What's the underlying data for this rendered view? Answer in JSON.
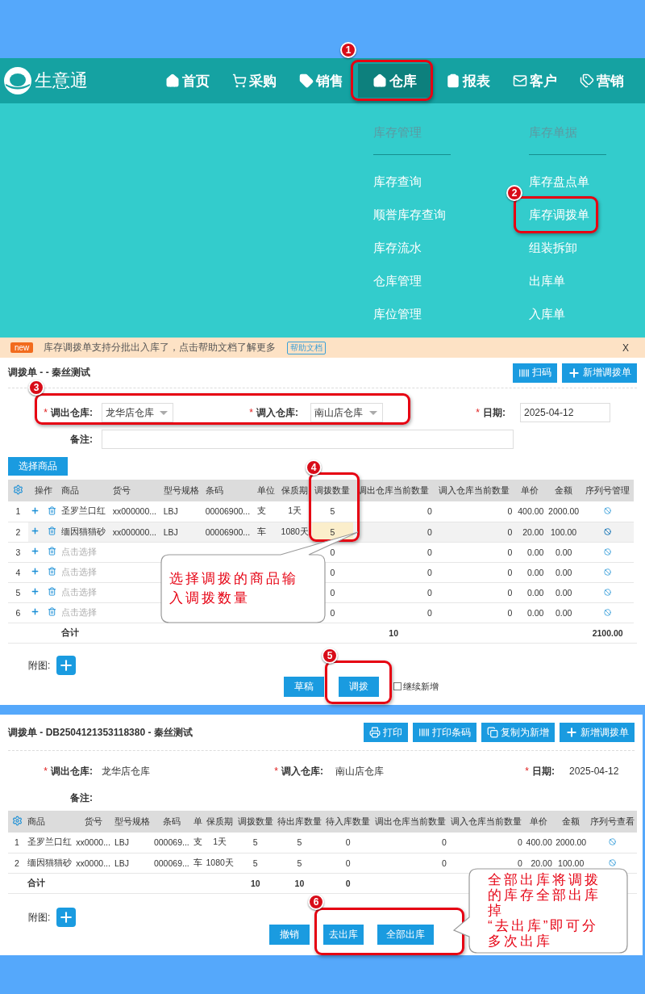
{
  "nav": {
    "logo": "生意通",
    "items": [
      {
        "label": "首页",
        "selected": false
      },
      {
        "label": "采购",
        "selected": false
      },
      {
        "label": "销售",
        "selected": false
      },
      {
        "label": "仓库",
        "selected": true
      },
      {
        "label": "报表",
        "selected": false
      },
      {
        "label": "客户",
        "selected": false
      },
      {
        "label": "营销",
        "selected": false
      }
    ]
  },
  "menu": {
    "columns": [
      {
        "title": "库存管理",
        "items": [
          "库存查询",
          "顺誉库存查询",
          "库存流水",
          "仓库管理",
          "库位管理"
        ]
      },
      {
        "title": "库存单据",
        "items": [
          "库存盘点单",
          "库存调拨单",
          "组装拆卸",
          "出库单",
          "入库单"
        ]
      }
    ]
  },
  "notice": {
    "badge": "new",
    "text": "库存调拨单支持分批出入库了，点击帮助文档了解更多",
    "link": "帮助文档",
    "close": "X"
  },
  "draft": {
    "title": "调拨单 - - 秦丝测试",
    "buttons": [
      "扫码",
      "新增调拨单"
    ],
    "fields": [
      {
        "mark": "*",
        "label": "调出仓库:",
        "value": "龙华店仓库",
        "kind": "select"
      },
      {
        "mark": "*",
        "label": "调入仓库:",
        "value": "南山店仓库",
        "kind": "select"
      },
      {
        "mark": "*",
        "label": "日期:",
        "value": "2025-04-12",
        "kind": "input"
      },
      {
        "label": "备注:",
        "kind": "input"
      }
    ],
    "select_button": "选择商品",
    "table": {
      "columns": [
        "操作",
        "商品",
        "货号",
        "型号规格",
        "条码",
        "单位",
        "保质期",
        "调拨数量",
        "调出仓库当前数量",
        "调入仓库当前数量",
        "单价",
        "金额",
        "序列号管理"
      ],
      "rows": [
        {
          "index": "1",
          "kind": "item",
          "selected": false,
          "product": "圣罗兰口红",
          "sku": "xx000000...",
          "spec": "LBJ",
          "barcode": "00006900...",
          "unit": "支",
          "shelf_life": "1天",
          "quantity": "5",
          "out_stock": "0",
          "in_stock": "0",
          "price": "400.00",
          "amount": "2000.00"
        },
        {
          "index": "2",
          "kind": "item",
          "selected": true,
          "product": "缅因猫猫砂",
          "sku": "xx000000...",
          "spec": "LBJ",
          "barcode": "00006900...",
          "unit": "车",
          "shelf_life": "1080天",
          "quantity": "5",
          "out_stock": "0",
          "in_stock": "0",
          "price": "20.00",
          "amount": "100.00"
        },
        {
          "index": "3",
          "kind": "empty",
          "selected": false,
          "placeholder": "点击选择",
          "quantity": "0",
          "out_stock": "0",
          "in_stock": "0",
          "price": "0.00",
          "amount": "0.00"
        },
        {
          "index": "4",
          "kind": "empty",
          "selected": false,
          "placeholder": "点击选择",
          "quantity": "0",
          "out_stock": "0",
          "in_stock": "0",
          "price": "0.00",
          "amount": "0.00"
        },
        {
          "index": "5",
          "kind": "empty",
          "selected": false,
          "placeholder": "点击选择",
          "quantity": "0",
          "out_stock": "0",
          "in_stock": "0",
          "price": "0.00",
          "amount": "0.00"
        },
        {
          "index": "6",
          "kind": "empty",
          "selected": false,
          "placeholder": "点击选择",
          "quantity": "0",
          "out_stock": "0",
          "in_stock": "0",
          "price": "0.00",
          "amount": "0.00"
        }
      ],
      "total": {
        "label": "合计",
        "quantity": "10",
        "amount": "2100.00"
      }
    },
    "attach_label": "附图:",
    "actions": [
      "草稿",
      "调拨"
    ],
    "continue": {
      "label": "继续新增",
      "checked": false
    }
  },
  "detail": {
    "title": "调拨单 - DB2504121353118380 - 秦丝测试",
    "buttons": [
      "打印",
      "打印条码",
      "复制为新增",
      "新增调拨单"
    ],
    "fields": [
      {
        "mark": "*",
        "label": "调出仓库:",
        "value": "龙华店仓库",
        "kind": "text"
      },
      {
        "mark": "*",
        "label": "调入仓库:",
        "value": "南山店仓库",
        "kind": "text"
      },
      {
        "mark": "*",
        "label": "日期:",
        "value": "2025-04-12",
        "kind": "text"
      },
      {
        "label": "备注:",
        "kind": "text"
      }
    ],
    "table": {
      "columns": [
        "商品",
        "货号",
        "型号规格",
        "条码",
        "单",
        "保质期",
        "调拨数量",
        "待出库数量",
        "待入库数量",
        "调出仓库当前数量",
        "调入仓库当前数量",
        "单价",
        "金额",
        "序列号查看"
      ],
      "rows": [
        {
          "index": "1",
          "product": "圣罗兰口红",
          "sku": "xx0000...",
          "spec": "LBJ",
          "barcode": "000069...",
          "unit": "支",
          "shelf_life": "1天",
          "quantity": "5",
          "pending_out": "5",
          "pending_in": "0",
          "out_stock": "0",
          "in_stock": "0",
          "price": "400.00",
          "amount": "2000.00"
        },
        {
          "index": "2",
          "product": "缅因猫猫砂",
          "sku": "xx0000...",
          "spec": "LBJ",
          "barcode": "000069...",
          "unit": "车",
          "shelf_life": "1080天",
          "quantity": "5",
          "pending_out": "5",
          "pending_in": "0",
          "out_stock": "0",
          "in_stock": "0",
          "price": "20.00",
          "amount": "100.00"
        }
      ],
      "total": {
        "label": "合计",
        "quantity": "10",
        "pending_out": "10",
        "pending_in": "0"
      }
    },
    "attach_label": "附图:",
    "actions": [
      "撤销",
      "去出库",
      "全部出库"
    ]
  },
  "steps": [
    "1",
    "2",
    "3",
    "4",
    "5",
    "6"
  ],
  "callouts": [
    "选择调拨的商品输入调拨数量",
    "全部出库将调拨的库存全部出库掉\n“去出库”即可分多次出库"
  ]
}
